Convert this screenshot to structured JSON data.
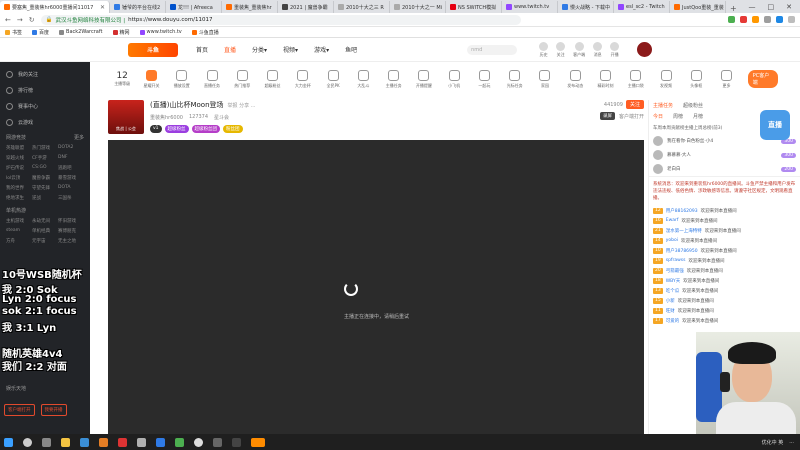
{
  "browser": {
    "tabs": [
      {
        "label": "要塞焦_重装焦hr6000重播间11017"
      },
      {
        "label": "锤爷的平台在线2"
      },
      {
        "label": "龙!!! | Afreeca"
      },
      {
        "label": "重装焦_重装焦hr"
      },
      {
        "label": "2021 | 魔兽争霸"
      },
      {
        "label": "2010十大之三 R"
      },
      {
        "label": "2010十大之一 Mi"
      },
      {
        "label": "NS SWITCH模拟"
      },
      {
        "label": "www.twitch.tv"
      },
      {
        "label": "慢火战略 - 下载中"
      },
      {
        "label": "esl_sc2 - Twitch"
      },
      {
        "label": "JustQoo重装_重装"
      }
    ],
    "new_tab": "+",
    "window_controls": [
      "—",
      "□",
      "✕"
    ],
    "url_secure": "🔒",
    "url_prefix": "武汉斗鱼网络科技有限公司 |",
    "url_host": "https://www.douyu.com/11017",
    "bookmarks": [
      "书签",
      "百度",
      "Back2Warcraft",
      "精网",
      "www.twitch.tv",
      "斗鱼直播"
    ]
  },
  "site": {
    "logo": "斗鱼",
    "nav": [
      "首页",
      "直播",
      "分类▾",
      "视频▾",
      "游戏▾",
      "鱼吧"
    ],
    "search_placeholder": "nmd",
    "header_icons": [
      "历史",
      "关注",
      "客户端",
      "消息",
      "开播"
    ]
  },
  "sidebar": {
    "items": [
      "我的关注",
      "排行榜",
      "赛事中心",
      "云游戏"
    ],
    "section1": "网游竞技",
    "section1_extra": "更多",
    "grid1": [
      "英雄联盟",
      "热门游戏",
      "DOTA2",
      "穿越火线",
      "CF手游",
      "DNF",
      "炉石传说",
      "CS:GO",
      "逃跑吧",
      "lol云顶",
      "魔兽争霸",
      "暴雪游戏",
      "我的世界",
      "守望先锋",
      "DOTA",
      "绝地求生",
      "逆战",
      "三国杀"
    ],
    "section2": "单机热游",
    "grid2": [
      "主机游戏",
      "永劫无间",
      "怀旧游戏",
      "steam",
      "单机经典",
      "赛博朋克",
      "方舟",
      "元宇宙",
      "无主之地"
    ],
    "section3": "娱乐天地",
    "btn_client": "客户端打开",
    "btn_live": "我要开播"
  },
  "overlay_lines": [
    "10号WSB随机杯",
    "我 2:0 Sok",
    "Lyn 2:0 focus",
    "sok 2:1 focus",
    "我 3:1 Lyn",
    "随机英雄4v4",
    "我们 2:2 对面"
  ],
  "catbar": {
    "count": "12",
    "count_label": "主播等级",
    "items": [
      "星耀开关",
      "播放设置",
      "直播任务",
      "热门推荐",
      "超级粉丝",
      "大力金杯",
      "全民PK",
      "大乱斗",
      "主播任务",
      "开播提醒",
      "小飞机",
      "一起玩",
      "光标任务",
      "家园",
      "发布动态",
      "精彩时刻",
      "主播口袋",
      "发视频",
      "头像框",
      "更多"
    ],
    "pc_label": "PC客户端"
  },
  "stream": {
    "avatar_caption": "焦战 | 公会",
    "title": "(直播)山比杯Moon登场",
    "title_extra": "举报  分享  ...",
    "streamer": "重装焦hr6000",
    "followers": "127374",
    "rank": "星斗会",
    "badges": [
      "v1",
      "超级粉丝",
      "超级粉丝团",
      "粉丝团"
    ],
    "room_id": "ID:11017",
    "follow_label": "关注",
    "follow_count": "441909",
    "tag": "录屏",
    "client_open": "客户端打开"
  },
  "video": {
    "loading_text": "主播正在连接中，请稍后重试"
  },
  "chat": {
    "tabs": [
      "主播任务",
      "超级粉丝"
    ],
    "notice": "车周本周贡献榜主播上周总榜(前3)",
    "rank_tabs": [
      "今日",
      "周榜",
      "月榜"
    ],
    "ranks": [
      {
        "name": "我在看你·白色粉丝·小4",
        "pts": "300"
      },
      {
        "name": "慕慕慕·大人",
        "pts": "300"
      },
      {
        "name": "老白白",
        "pts": "200"
      }
    ],
    "system_msg": "系统消息：欢迎来到重装焦hr6000的直播间。斗鱼严禁主播和用户发布违法违规、低俗色情、涉政敏感等信息。请遵守社区规定，文明观看直播。",
    "lines": [
      {
        "lv": "12",
        "name": "用户88162093",
        "text": "欢迎来到本直播间"
      },
      {
        "lv": "16",
        "name": "Ewarf",
        "text": "欢迎来到本直播间"
      },
      {
        "lv": "21",
        "name": "湿水第一上海特特",
        "text": "欢迎来到本直播间"
      },
      {
        "lv": "14",
        "name": "yoboi",
        "text": "欢迎来到本直播间"
      },
      {
        "lv": "10",
        "name": "用户38786950",
        "text": "欢迎来到本直播间"
      },
      {
        "lv": "19",
        "name": "spfrawss",
        "text": "欢迎来到本直播间"
      },
      {
        "lv": "20",
        "name": "弓箭最强",
        "text": "欢迎来到本直播间"
      },
      {
        "lv": "18",
        "name": "WBY天",
        "text": "欢迎来到本直播间"
      },
      {
        "lv": "13",
        "name": "吃个瓜",
        "text": "欢迎来到本直播间"
      },
      {
        "lv": "15",
        "name": "小新",
        "text": "欢迎来到本直播间"
      },
      {
        "lv": "11",
        "name": "旺财",
        "text": "欢迎来到本直播间"
      },
      {
        "lv": "17",
        "name": "可爱的",
        "text": "欢迎来到本直播间"
      }
    ]
  },
  "qiyu_badge": "直播",
  "taskbar": {
    "tray_text": "优化中 英",
    "clock": "..."
  }
}
